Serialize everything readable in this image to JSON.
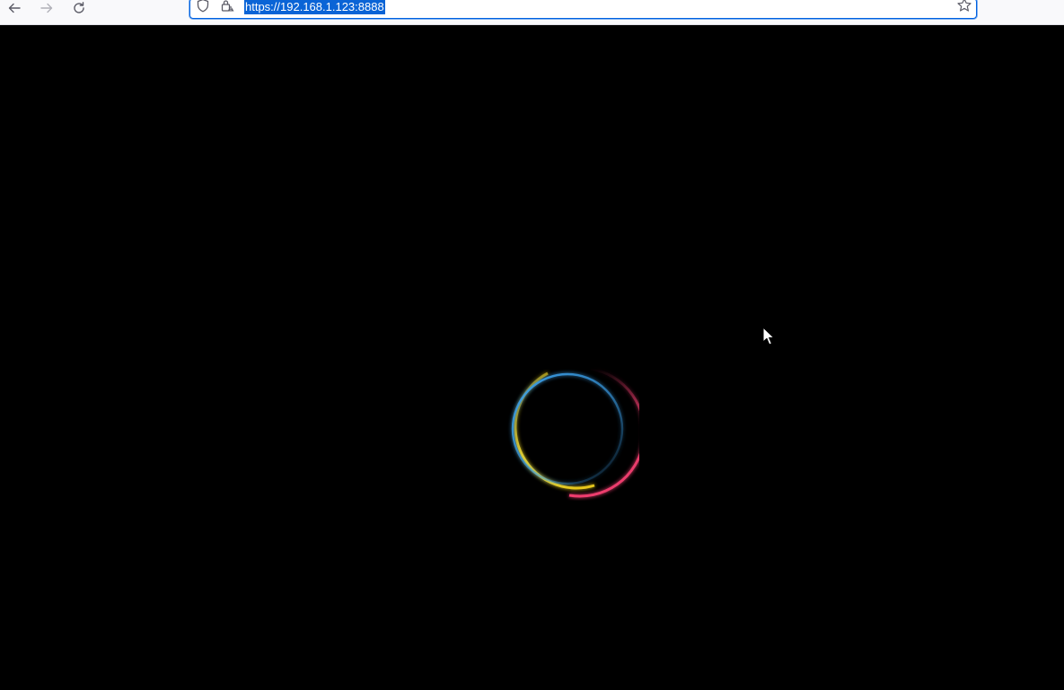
{
  "browser": {
    "url": "https://192.168.1.123:8888",
    "icons": {
      "back": "arrow-left-icon",
      "forward": "arrow-right-icon",
      "reload": "reload-icon",
      "tracking": "shield-icon",
      "security": "insecure-lock-icon",
      "bookmark": "star-icon"
    },
    "colors": {
      "toolbar_bg": "#f9f9fb",
      "url_selection": "#0a64d6",
      "focus_ring": "#0061e0"
    }
  },
  "page": {
    "background": "#000000",
    "loader": {
      "icon": "loading-spinner-icon",
      "colors": [
        "#3a9ee8",
        "#f2d21e",
        "#ef3d6e"
      ]
    }
  }
}
